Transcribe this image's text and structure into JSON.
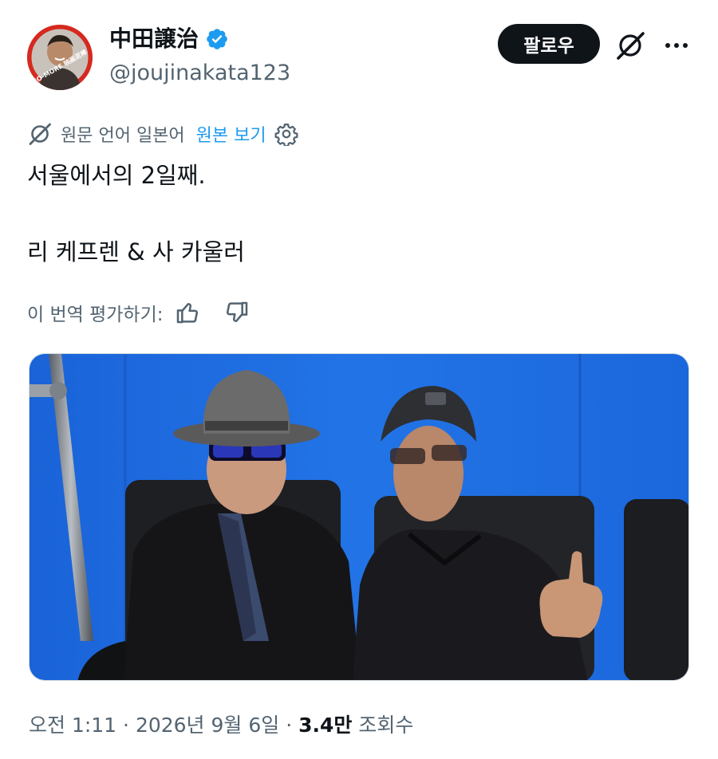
{
  "author": {
    "display_name": "中田譲治",
    "handle": "@joujinakata123",
    "avatar_text": "NO-MORE 映画泥棒"
  },
  "actions": {
    "follow_label": "팔로우"
  },
  "translation": {
    "notice": "원문 언어 일본어",
    "show_original": "원본 보기"
  },
  "tweet": {
    "line1": "서울에서의 2일째.",
    "line2": "리 케프렌 & 사 카울러"
  },
  "rate": {
    "label": "이 번역 평가하기:"
  },
  "meta": {
    "time": "오전 1:11",
    "separator1": " · ",
    "date": "2026년 9월 6일",
    "separator2": " · ",
    "views_count": "3.4만",
    "views_label": " 조회수"
  },
  "colors": {
    "accent": "#1d9bf0",
    "text": "#0f1419",
    "secondary": "#536471",
    "photo_bg": "#1f6fe0"
  },
  "icons": {
    "verified": "verified-badge-icon",
    "grok": "grok-icon",
    "more": "more-icon",
    "translate": "translate-icon",
    "settings": "gear-icon",
    "thumbs_up": "thumbs-up-icon",
    "thumbs_down": "thumbs-down-icon"
  }
}
